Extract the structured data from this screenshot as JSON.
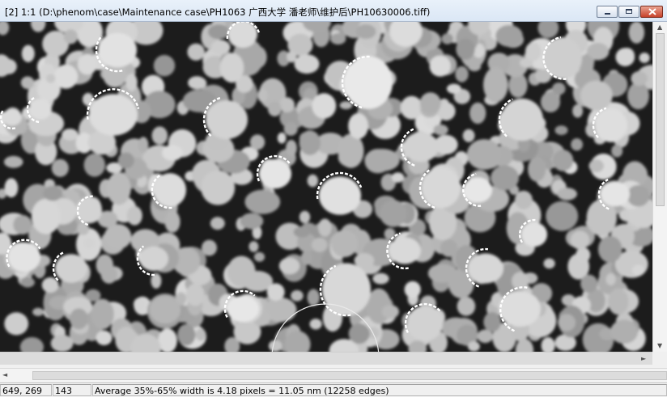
{
  "window": {
    "title": "[2] 1:1 (D:\\phenom\\case\\Maintenance case\\PH1063 广西大学 潘老师\\维护后\\PH10630006.tiff)",
    "controls": [
      "minimize",
      "maximize",
      "close"
    ]
  },
  "image": {
    "description_icon": "sem-micrograph",
    "colors": {
      "background": "#1a1a1a",
      "particle": "#c8c8c8",
      "edge_marks": "#ffffff"
    }
  },
  "statusbar": {
    "cursor_position": "649, 269",
    "pixel_value": "143",
    "message": "Average 35%-65% width is 4.18 pixels = 11.05 nm (12258 edges)"
  },
  "scroll_arrows": {
    "up": "▲",
    "down": "▼",
    "left": "◄",
    "right": "►"
  },
  "colors": {
    "titlebar": "#dbe7f5",
    "close_button": "#c7412a"
  }
}
